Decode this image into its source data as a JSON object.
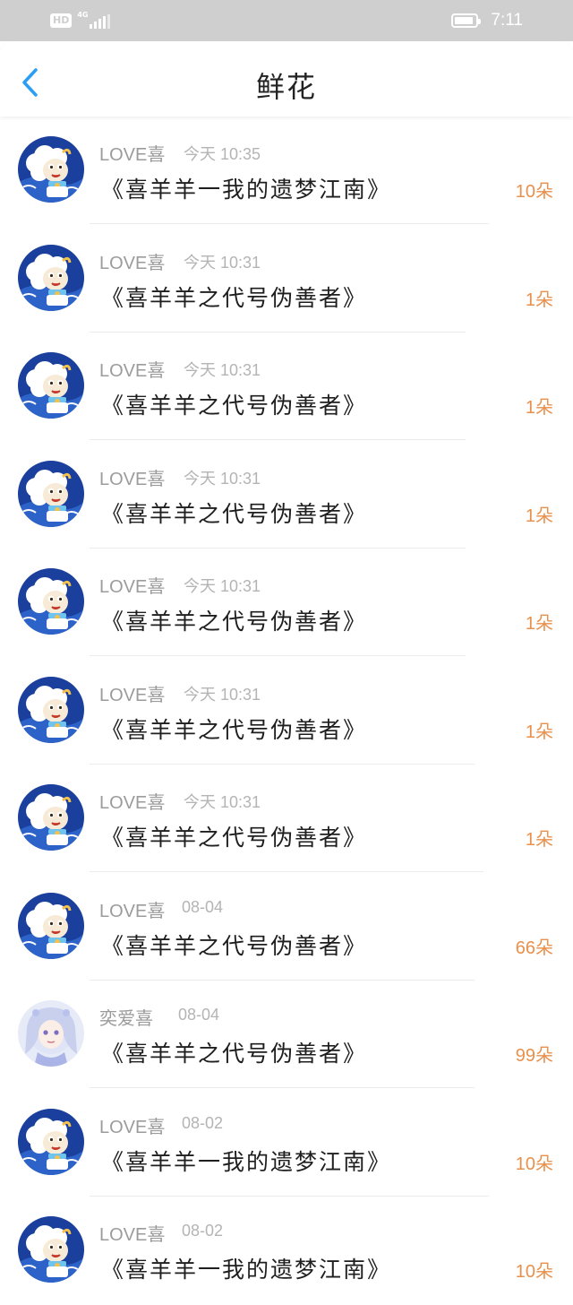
{
  "status_bar": {
    "hd_label": "HD",
    "network_label": "4G",
    "time": "7:11"
  },
  "header": {
    "title": "鲜花"
  },
  "colors": {
    "accent_blue": "#2a9df4",
    "count_orange": "#e8904c",
    "avatar_a": "#1a3f9c",
    "avatar_b": "#e6ebf7"
  },
  "messages": [
    {
      "sender": "LOVE喜",
      "time": "今天 10:35",
      "gift": "《喜羊羊一我的遗梦江南》",
      "count": "10朵"
    },
    {
      "sender": "LOVE喜",
      "time": "今天 10:31",
      "gift": "《喜羊羊之代号伪善者》",
      "count": "1朵"
    },
    {
      "sender": "LOVE喜",
      "time": "今天 10:31",
      "gift": "《喜羊羊之代号伪善者》",
      "count": "1朵"
    },
    {
      "sender": "LOVE喜",
      "time": "今天 10:31",
      "gift": "《喜羊羊之代号伪善者》",
      "count": "1朵"
    },
    {
      "sender": "LOVE喜",
      "time": "今天 10:31",
      "gift": "《喜羊羊之代号伪善者》",
      "count": "1朵"
    },
    {
      "sender": "LOVE喜",
      "time": "今天 10:31",
      "gift": "《喜羊羊之代号伪善者》",
      "count": "1朵"
    },
    {
      "sender": "LOVE喜",
      "time": "今天 10:31",
      "gift": "《喜羊羊之代号伪善者》",
      "count": "1朵"
    },
    {
      "sender": "LOVE喜",
      "time": "08-04",
      "gift": "《喜羊羊之代号伪善者》",
      "count": "66朵"
    },
    {
      "sender": "奕爱喜",
      "time": "08-04",
      "gift": "《喜羊羊之代号伪善者》",
      "count": "99朵"
    },
    {
      "sender": "LOVE喜",
      "time": "08-02",
      "gift": "《喜羊羊一我的遗梦江南》",
      "count": "10朵"
    },
    {
      "sender": "LOVE喜",
      "time": "08-02",
      "gift": "《喜羊羊一我的遗梦江南》",
      "count": "10朵"
    }
  ]
}
